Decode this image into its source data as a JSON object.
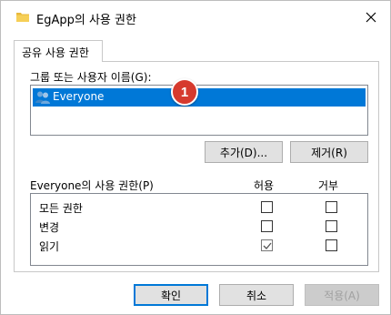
{
  "window": {
    "title": "EgApp의 사용 권한"
  },
  "tab": {
    "label": "공유 사용 권한"
  },
  "users": {
    "label": "그룹 또는 사용자 이름(G):",
    "items": [
      {
        "name": "Everyone",
        "selected": true
      }
    ],
    "badge": "1",
    "add_button": "추가(D)...",
    "remove_button": "제거(R)"
  },
  "permissions": {
    "label": "Everyone의 사용 권한(P)",
    "col_allow": "허용",
    "col_deny": "거부",
    "rows": [
      {
        "name": "모든 권한",
        "allow": false,
        "deny": false
      },
      {
        "name": "변경",
        "allow": false,
        "deny": false
      },
      {
        "name": "읽기",
        "allow": true,
        "deny": false
      }
    ]
  },
  "footer": {
    "ok": "확인",
    "cancel": "취소",
    "apply": "적용(A)"
  },
  "colors": {
    "selection": "#0078d7",
    "badge": "#d63a2e",
    "button_face": "#e1e1e1"
  }
}
